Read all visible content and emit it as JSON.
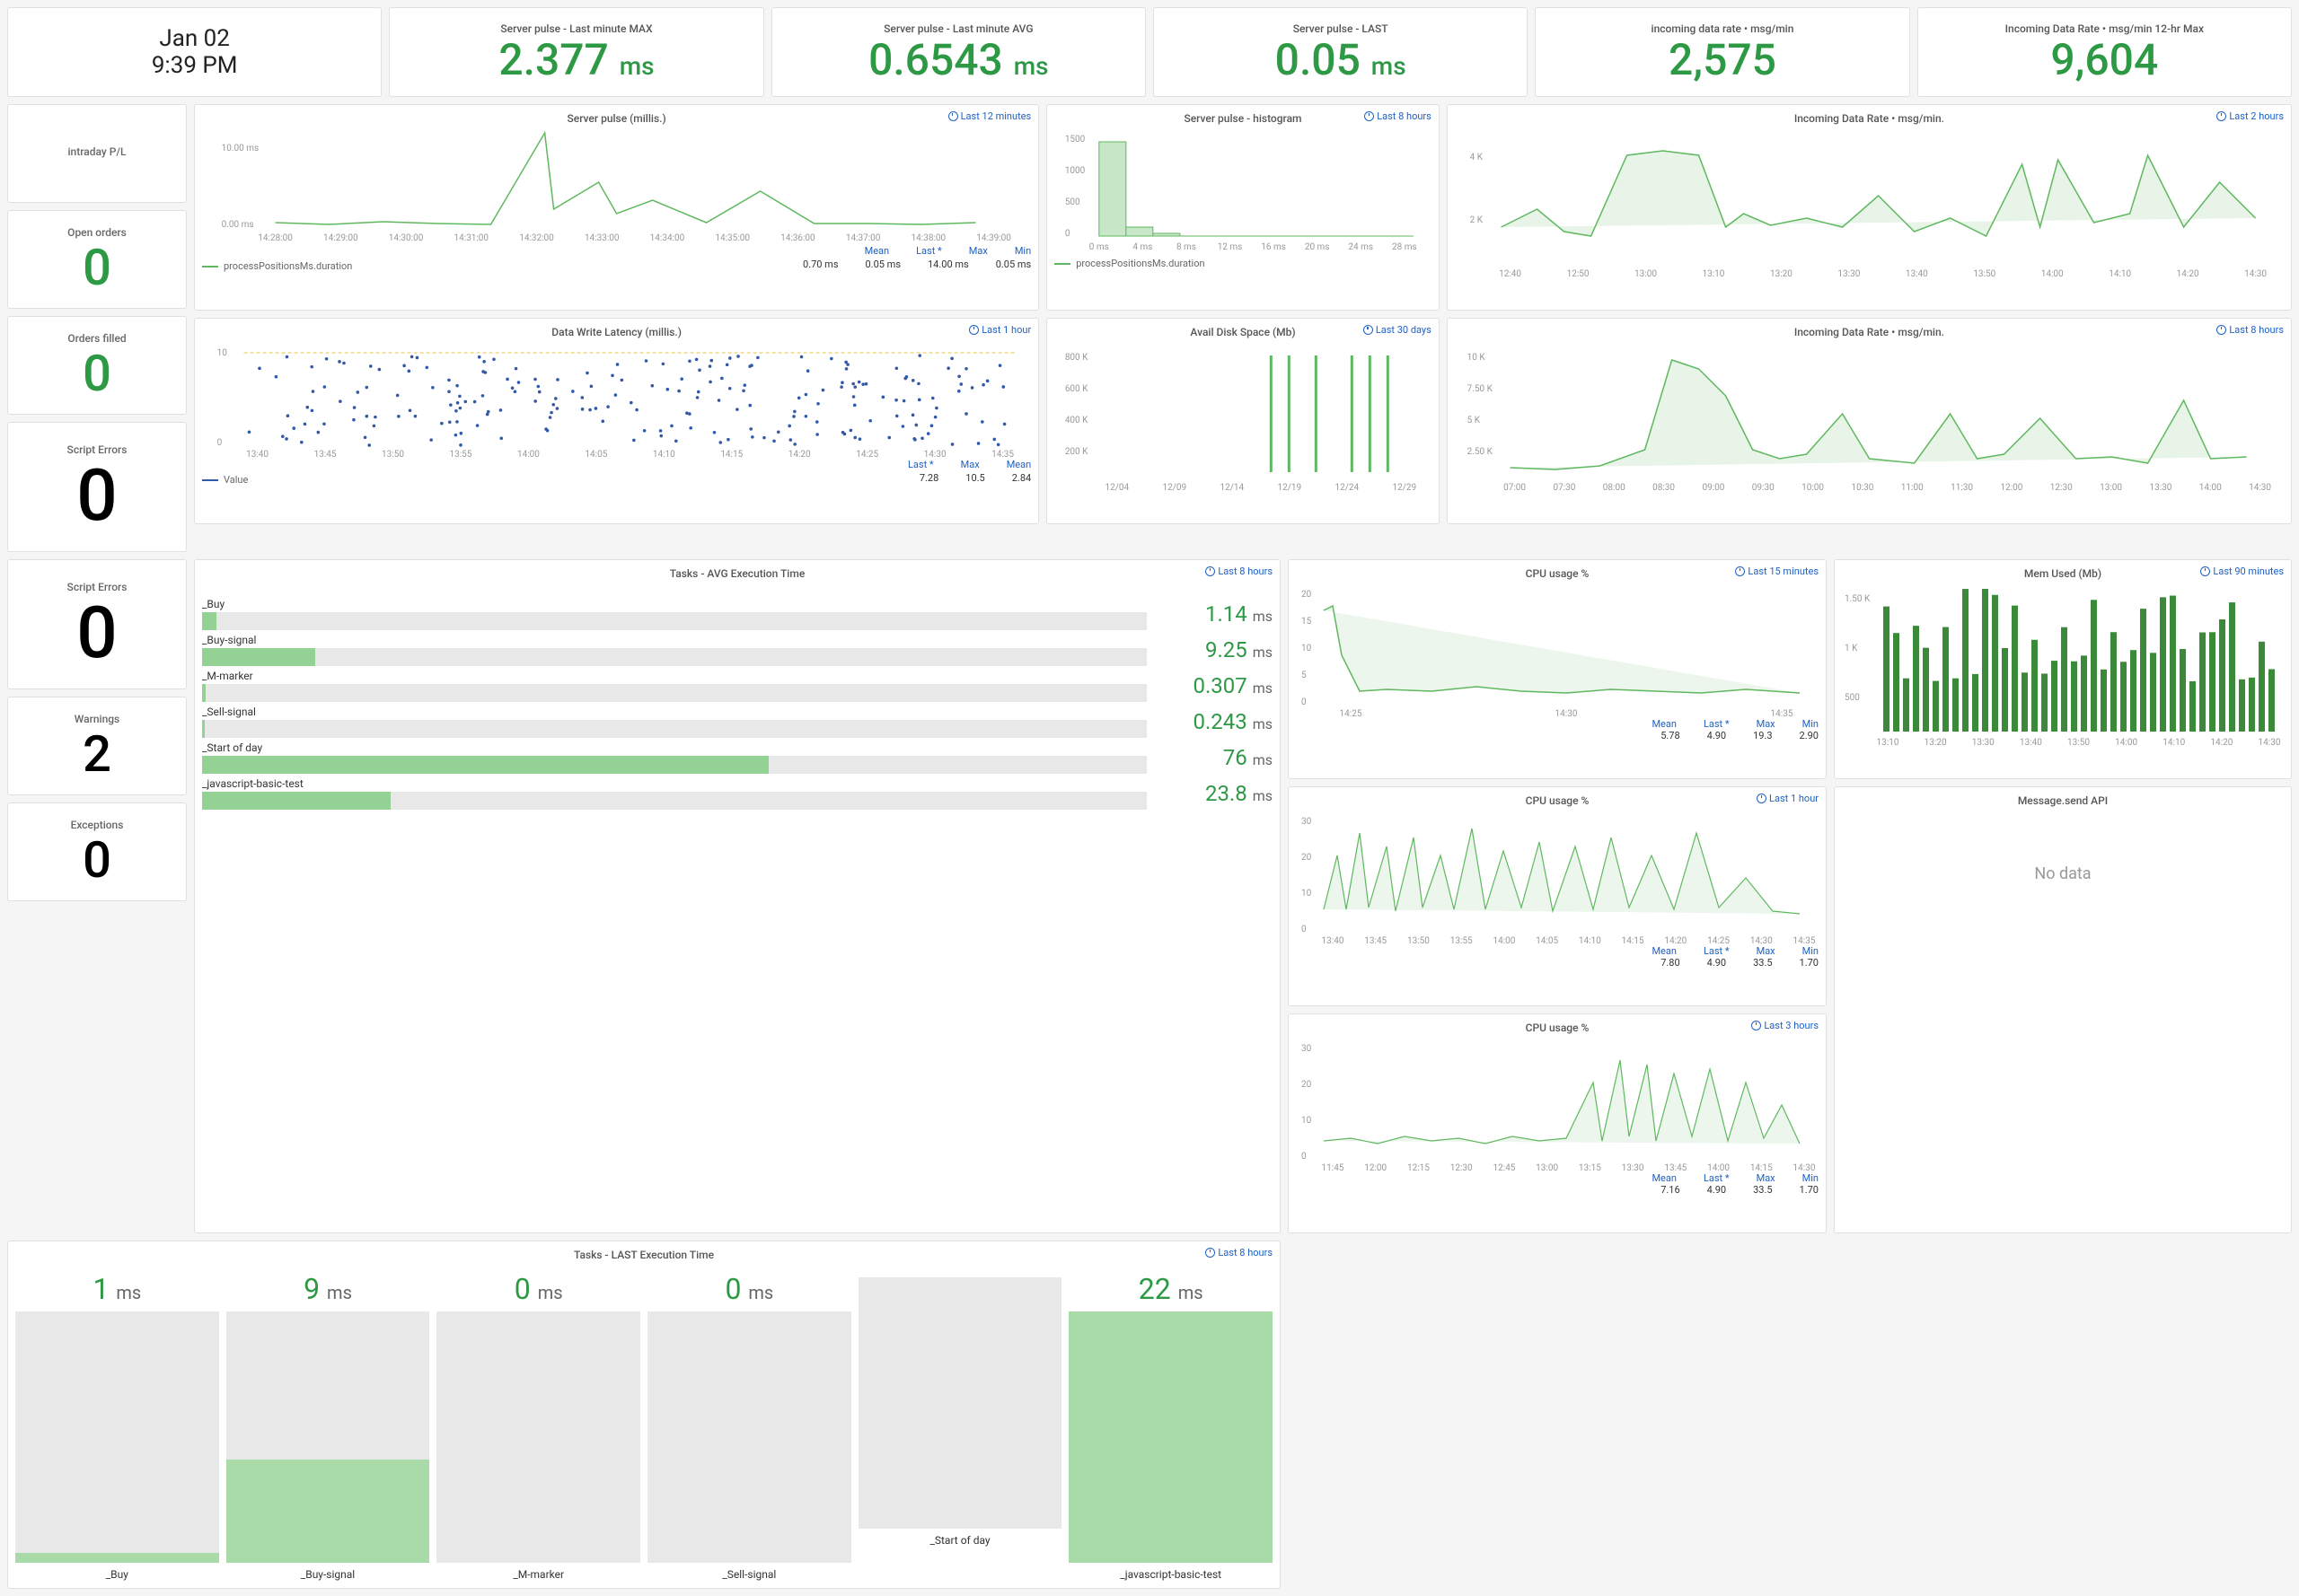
{
  "datetime": {
    "date": "Jan 02",
    "time": "9:39 PM"
  },
  "top_stats": [
    {
      "title": "Server pulse - Last minute MAX",
      "value": "2.377",
      "unit": "ms"
    },
    {
      "title": "Server pulse - Last minute AVG",
      "value": "0.6543",
      "unit": "ms"
    },
    {
      "title": "Server pulse - LAST",
      "value": "0.05",
      "unit": "ms"
    },
    {
      "title": "incoming data rate • msg/min",
      "value": "2,575",
      "unit": ""
    },
    {
      "title": "Incoming Data Rate • msg/min 12-hr Max",
      "value": "9,604",
      "unit": ""
    }
  ],
  "side_stats": [
    {
      "title": "intraday P/L",
      "value": "",
      "color": "black"
    },
    {
      "title": "Open orders",
      "value": "0",
      "color": "green"
    },
    {
      "title": "Orders filled",
      "value": "0",
      "color": "green"
    },
    {
      "title": "Script Errors",
      "value": "0",
      "color": "black",
      "tall": true
    },
    {
      "title": "Script Errors",
      "value": "0",
      "color": "black",
      "tall": true
    },
    {
      "title": "Warnings",
      "value": "2",
      "color": "black"
    },
    {
      "title": "Exceptions",
      "value": "0",
      "color": "black"
    }
  ],
  "server_pulse": {
    "title": "Server pulse (millis.)",
    "range": "Last 12 minutes",
    "legend": "processPositionsMs.duration",
    "stats": {
      "Mean": "0.70 ms",
      "Last *": "0.05 ms",
      "Max": "14.00 ms",
      "Min": "0.05 ms"
    },
    "x_ticks": [
      "14:28:00",
      "14:29:00",
      "14:30:00",
      "14:31:00",
      "14:32:00",
      "14:33:00",
      "14:34:00",
      "14:35:00",
      "14:36:00",
      "14:37:00",
      "14:38:00",
      "14:39:00"
    ],
    "y_ticks": [
      "0.00 ms",
      "10.00 ms"
    ]
  },
  "server_pulse_hist": {
    "title": "Server pulse - histogram",
    "range": "Last 8 hours",
    "legend": "processPositionsMs.duration",
    "x_ticks": [
      "0 ms",
      "4 ms",
      "8 ms",
      "12 ms",
      "16 ms",
      "20 ms",
      "24 ms",
      "28 ms"
    ],
    "y_ticks": [
      "0",
      "500",
      "1000",
      "1500"
    ]
  },
  "incoming_2h": {
    "title": "Incoming Data Rate • msg/min.",
    "range": "Last 2 hours",
    "x_ticks": [
      "12:40",
      "12:50",
      "13:00",
      "13:10",
      "13:20",
      "13:30",
      "13:40",
      "13:50",
      "14:00",
      "14:10",
      "14:20",
      "14:30"
    ],
    "y_ticks": [
      "2 K",
      "4 K"
    ]
  },
  "data_write": {
    "title": "Data Write Latency (millis.)",
    "range": "Last 1 hour",
    "legend": "Value",
    "stats": {
      "Last *": "7.28",
      "Max": "10.5",
      "Mean": "2.84"
    },
    "x_ticks": [
      "13:40",
      "13:45",
      "13:50",
      "13:55",
      "14:00",
      "14:05",
      "14:10",
      "14:15",
      "14:20",
      "14:25",
      "14:30",
      "14:35"
    ],
    "y_ticks": [
      "0",
      "10"
    ]
  },
  "disk": {
    "title": "Avail Disk Space (Mb)",
    "range": "Last 30 days",
    "x_ticks": [
      "12/04",
      "12/09",
      "12/14",
      "12/19",
      "12/24",
      "12/29"
    ],
    "y_ticks": [
      "200 K",
      "400 K",
      "600 K",
      "800 K"
    ]
  },
  "incoming_8h": {
    "title": "Incoming Data Rate • msg/min.",
    "range": "Last 8 hours",
    "x_ticks": [
      "07:00",
      "07:30",
      "08:00",
      "08:30",
      "09:00",
      "09:30",
      "10:00",
      "10:30",
      "11:00",
      "11:30",
      "12:00",
      "12:30",
      "13:00",
      "13:30",
      "14:00",
      "14:30"
    ],
    "y_ticks": [
      "2.50 K",
      "5 K",
      "7.50 K",
      "10 K"
    ]
  },
  "tasks_avg": {
    "title": "Tasks - AVG Execution Time",
    "range": "Last 8 hours",
    "items": [
      {
        "label": "_Buy",
        "value": "1.14",
        "pct": 1.5
      },
      {
        "label": "_Buy-signal",
        "value": "9.25",
        "pct": 12
      },
      {
        "label": "_M-marker",
        "value": "0.307",
        "pct": 0.4
      },
      {
        "label": "_Sell-signal",
        "value": "0.243",
        "pct": 0.3
      },
      {
        "label": "_Start of day",
        "value": "76",
        "pct": 60
      },
      {
        "label": "_javascript-basic-test",
        "value": "23.8",
        "pct": 20
      }
    ]
  },
  "tasks_last": {
    "title": "Tasks - LAST Execution Time",
    "range": "Last 8 hours",
    "items": [
      {
        "label": "_Buy",
        "value": "1",
        "pct": 4
      },
      {
        "label": "_Buy-signal",
        "value": "9",
        "pct": 41
      },
      {
        "label": "_M-marker",
        "value": "0",
        "pct": 0
      },
      {
        "label": "_Sell-signal",
        "value": "0",
        "pct": 0
      },
      {
        "label": "_Start of day",
        "value": "",
        "pct": 0
      },
      {
        "label": "_javascript-basic-test",
        "value": "22",
        "pct": 100
      }
    ]
  },
  "cpu_15m": {
    "title": "CPU usage %",
    "range": "Last 15 minutes",
    "stats": {
      "Mean": "5.78",
      "Last *": "4.90",
      "Max": "19.3",
      "Min": "2.90"
    },
    "x_ticks": [
      "14:25",
      "14:30",
      "14:35"
    ],
    "y_ticks": [
      "0",
      "5",
      "10",
      "15",
      "20"
    ]
  },
  "cpu_1h": {
    "title": "CPU usage %",
    "range": "Last 1 hour",
    "stats": {
      "Mean": "7.80",
      "Last *": "4.90",
      "Max": "33.5",
      "Min": "1.70"
    },
    "x_ticks": [
      "13:40",
      "13:45",
      "13:50",
      "13:55",
      "14:00",
      "14:05",
      "14:10",
      "14:15",
      "14:20",
      "14:25",
      "14:30",
      "14:35"
    ],
    "y_ticks": [
      "0",
      "10",
      "20",
      "30"
    ]
  },
  "cpu_3h": {
    "title": "CPU usage %",
    "range": "Last 3 hours",
    "stats": {
      "Mean": "7.16",
      "Last *": "4.90",
      "Max": "33.5",
      "Min": "1.70"
    },
    "x_ticks": [
      "11:45",
      "12:00",
      "12:15",
      "12:30",
      "12:45",
      "13:00",
      "13:15",
      "13:30",
      "13:45",
      "14:00",
      "14:15",
      "14:30"
    ],
    "y_ticks": [
      "0",
      "10",
      "20",
      "30"
    ]
  },
  "mem": {
    "title": "Mem Used (Mb)",
    "range": "Last 90 minutes",
    "x_ticks": [
      "13:10",
      "13:20",
      "13:30",
      "13:40",
      "13:50",
      "14:00",
      "14:10",
      "14:20",
      "14:30"
    ],
    "y_ticks": [
      "500",
      "1 K",
      "1.50 K"
    ]
  },
  "msg_api": {
    "title": "Message.send API",
    "no_data": "No data"
  },
  "chart_data": [
    {
      "type": "line",
      "title": "Server pulse (millis.)",
      "x": [
        "14:28:00",
        "14:29:00",
        "14:30:00",
        "14:31:00",
        "14:32:00",
        "14:33:00",
        "14:34:00",
        "14:35:00",
        "14:36:00",
        "14:37:00",
        "14:38:00",
        "14:39:00"
      ],
      "values": [
        0.5,
        0.4,
        0.6,
        0.5,
        0.4,
        14.0,
        2.0,
        1.5,
        0.5,
        2.0,
        0.5,
        0.4
      ],
      "ylim": [
        0,
        14
      ],
      "ylabel": "ms",
      "series_name": "processPositionsMs.duration"
    },
    {
      "type": "bar",
      "title": "Server pulse - histogram",
      "categories": [
        "0",
        "2",
        "4",
        "6",
        "8",
        "10",
        "12",
        "14"
      ],
      "values": [
        1400,
        100,
        20,
        10,
        5,
        2,
        1,
        1
      ],
      "xlabel": "ms",
      "ylim": [
        0,
        1500
      ]
    },
    {
      "type": "area",
      "title": "Incoming Data Rate • msg/min. (2h)",
      "x": [
        "12:40",
        "12:50",
        "13:00",
        "13:10",
        "13:20",
        "13:30",
        "13:40",
        "13:50",
        "14:00",
        "14:10",
        "14:20",
        "14:30"
      ],
      "values": [
        2400,
        2100,
        4200,
        4100,
        2500,
        2300,
        2200,
        2700,
        2200,
        2600,
        3500,
        2575
      ],
      "ylim": [
        0,
        5000
      ]
    },
    {
      "type": "scatter",
      "title": "Data Write Latency (millis.)",
      "x_range": [
        "13:40",
        "14:35"
      ],
      "approx_values": [
        2,
        3,
        5,
        7,
        6,
        4,
        3,
        2,
        8,
        6,
        5,
        9,
        10,
        3,
        2,
        4,
        6,
        5,
        7,
        8,
        3,
        2,
        9,
        6,
        5,
        4,
        3,
        8,
        7,
        2,
        5,
        6,
        4,
        3,
        9,
        8,
        7,
        2,
        5,
        6,
        4,
        3
      ],
      "ylim": [
        0,
        10
      ],
      "threshold": 10
    },
    {
      "type": "bar",
      "title": "Avail Disk Space (Mb)",
      "categories": [
        "12/04",
        "12/09",
        "12/14",
        "12/19",
        "12/24",
        "12/29"
      ],
      "values": [
        0,
        0,
        0,
        800000,
        800000,
        800000
      ],
      "ylim": [
        0,
        800000
      ]
    },
    {
      "type": "area",
      "title": "Incoming Data Rate • msg/min. (8h)",
      "x": [
        "07:00",
        "07:30",
        "08:00",
        "08:30",
        "09:00",
        "09:30",
        "10:00",
        "10:30",
        "11:00",
        "11:30",
        "12:00",
        "12:30",
        "13:00",
        "13:30",
        "14:00",
        "14:30"
      ],
      "values": [
        1500,
        1400,
        1600,
        3500,
        9600,
        8500,
        3000,
        2200,
        2000,
        3800,
        2200,
        3900,
        2500,
        2200,
        4200,
        2575
      ],
      "ylim": [
        0,
        10000
      ]
    },
    {
      "type": "bar",
      "title": "Tasks - AVG Execution Time",
      "categories": [
        "_Buy",
        "_Buy-signal",
        "_M-marker",
        "_Sell-signal",
        "_Start of day",
        "_javascript-basic-test"
      ],
      "values": [
        1.14,
        9.25,
        0.307,
        0.243,
        76,
        23.8
      ],
      "xlabel": "ms",
      "orientation": "horizontal"
    },
    {
      "type": "bar",
      "title": "Tasks - LAST Execution Time",
      "categories": [
        "_Buy",
        "_Buy-signal",
        "_M-marker",
        "_Sell-signal",
        "_Start of day",
        "_javascript-basic-test"
      ],
      "values": [
        1,
        9,
        0,
        0,
        null,
        22
      ],
      "xlabel": "ms"
    },
    {
      "type": "line",
      "title": "CPU usage % (15m)",
      "x": [
        "14:25",
        "14:30",
        "14:35"
      ],
      "approx_values": [
        19,
        8,
        5,
        5,
        6,
        5,
        4,
        5,
        5,
        6,
        5,
        4,
        5,
        5,
        4,
        4.9
      ],
      "ylim": [
        0,
        20
      ]
    },
    {
      "type": "line",
      "title": "CPU usage % (1h)",
      "x": [
        "13:40",
        "14:35"
      ],
      "approx_values": [
        8,
        25,
        7,
        30,
        8,
        7,
        28,
        6,
        32,
        8,
        7,
        6,
        33,
        8,
        7,
        15,
        8,
        25,
        7,
        6,
        12,
        8,
        19,
        5,
        4.9
      ],
      "ylim": [
        0,
        35
      ]
    },
    {
      "type": "line",
      "title": "CPU usage % (3h)",
      "x": [
        "11:45",
        "14:30"
      ],
      "approx_values": [
        6,
        7,
        6,
        7,
        8,
        6,
        7,
        6,
        8,
        7,
        6,
        25,
        7,
        30,
        8,
        33,
        8,
        15,
        6,
        28,
        7,
        19,
        5,
        4.9
      ],
      "ylim": [
        0,
        35
      ]
    },
    {
      "type": "bar",
      "title": "Mem Used (Mb)",
      "x": [
        "13:10",
        "13:20",
        "13:30",
        "13:40",
        "13:50",
        "14:00",
        "14:10",
        "14:20",
        "14:30"
      ],
      "approx_values": [
        600,
        1400,
        500,
        1200,
        400,
        1350,
        550,
        1400,
        500,
        1300,
        600,
        1400,
        500,
        1350,
        550,
        1450,
        500,
        1400
      ],
      "ylim": [
        0,
        1500
      ]
    }
  ]
}
